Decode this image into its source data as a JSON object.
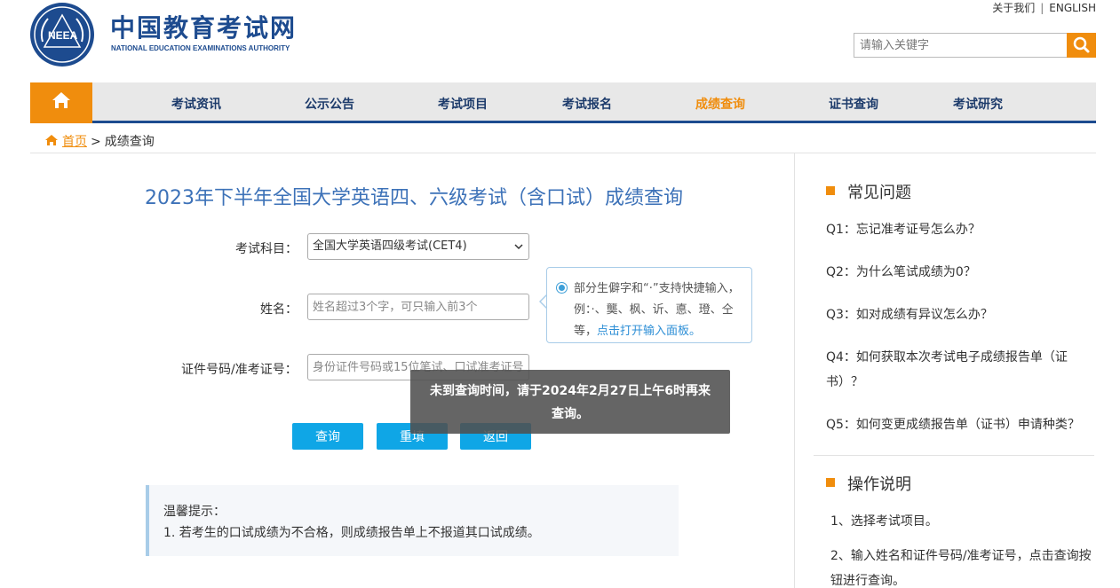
{
  "header": {
    "site_name": "中国教育考试网",
    "site_name_en": "NATIONAL EDUCATION EXAMINATIONS AUTHORITY",
    "logo_text": "NEEA",
    "about_link": "关于我们",
    "english_link": "ENGLISH",
    "search_placeholder": "请输入关键字"
  },
  "nav": {
    "items": [
      {
        "label": "考试资讯"
      },
      {
        "label": "公示公告"
      },
      {
        "label": "考试项目"
      },
      {
        "label": "考试报名"
      },
      {
        "label": "成绩查询",
        "active": true
      },
      {
        "label": "证书查询"
      },
      {
        "label": "考试研究"
      }
    ]
  },
  "breadcrumb": {
    "home": "首页",
    "separator": ">",
    "current": "成绩查询"
  },
  "main": {
    "title": "2023年下半年全国大学英语四、六级考试（含口试）成绩查询",
    "subject_label": "考试科目：",
    "subject_value": "全国大学英语四级考试(CET4)",
    "name_label": "姓名：",
    "name_placeholder": "姓名超过3个字，可只输入前3个",
    "id_label": "证件号码/准考证号：",
    "id_placeholder": "身份证件号码或15位笔试、口试准考证号",
    "tip_text": "部分生僻字和“·”支持快捷输入，例：·、龑、枫、䜣、悳、璒、仝等，",
    "tip_link": "点击打开输入面板。",
    "buttons": {
      "query": "查询",
      "reset": "重填",
      "back": "返回"
    },
    "toast": "未到查询时间，请于2024年2月27日上午6时再来查询。",
    "notice_title": "温馨提示：",
    "notice_item": "1. 若考生的口试成绩为不合格，则成绩报告单上不报道其口试成绩。"
  },
  "sidebar": {
    "faq_title": "常见问题",
    "faqs": [
      "Q1：忘记准考证号怎么办？",
      "Q2：为什么笔试成绩为0？",
      "Q3：如对成绩有异议怎么办？",
      "Q4：如何获取本次考试电子成绩报告单（证书）？",
      "Q5：如何变更成绩报告单（证书）申请种类？"
    ],
    "howto_title": "操作说明",
    "steps": [
      "1、选择考试项目。",
      "2、输入姓名和证件号码/准考证号，点击查询按钮进行查询。"
    ]
  },
  "colors": {
    "brand_blue": "#1d4b8f",
    "accent_orange": "#f08d0d",
    "button_blue": "#0fa6e6"
  }
}
